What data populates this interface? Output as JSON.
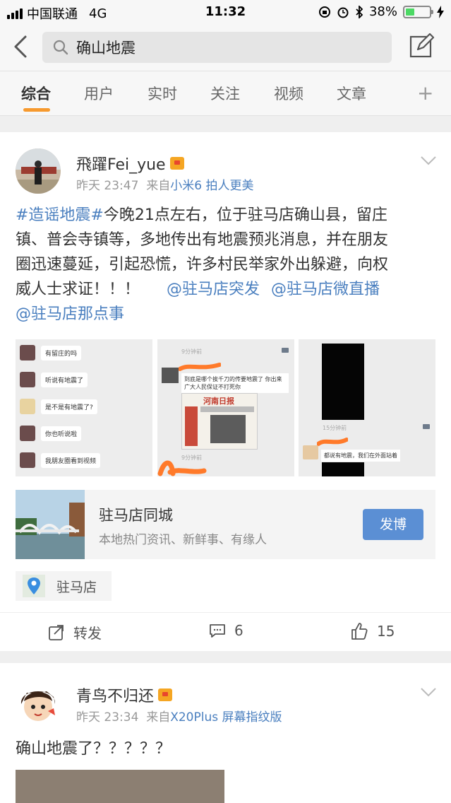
{
  "status_bar": {
    "carrier": "中国联通",
    "network": "4G",
    "time": "11:32",
    "battery": "38%",
    "battery_level": 0.38
  },
  "search": {
    "query": "确山地震"
  },
  "tabs": [
    {
      "label": "综合",
      "active": true
    },
    {
      "label": "用户"
    },
    {
      "label": "实时"
    },
    {
      "label": "关注"
    },
    {
      "label": "视频"
    },
    {
      "label": "文章"
    }
  ],
  "tab_plus": "+",
  "post1": {
    "username": "飛躍Fei_yue",
    "time": "昨天 23:47",
    "source_prefix": "来自",
    "source": "小米6 拍人更美",
    "text": {
      "hashtag": "#造谣地震#",
      "body_l1": "今晚21点左右，位于驻马店确山县，留庄",
      "body_l2": "镇、普会寺镇等，多地传出有地震预兆消息，并在朋友",
      "body_l3": "圈迅速蔓延，引起恐慌，许多村民举家外出躲避，向权",
      "body_l4": "威人士求证！！！",
      "mention1": "@驻马店突发",
      "mention2": "@驻马店微直播",
      "mention3": "@驻马店那点事"
    },
    "image1_chat": [
      "有留庄的吗",
      "听说有地震了",
      "是不是有地震了?",
      "你也听说啦",
      "我朋友圈看到视频"
    ],
    "image2": {
      "time_top": "9分钟前",
      "message": "到底是哪个挨千刀的传要地震了  你出来",
      "message2": "广大人民保证不打死你",
      "newspaper_title": "河南日报",
      "time_bottom": "9分钟前"
    },
    "image3": {
      "time": "15分钟前",
      "message": "都说有地震，我们在外面站着"
    },
    "page_card": {
      "title": "驻马店同城",
      "desc": "本地热门资讯、新鲜事、有缘人",
      "button": "发博"
    },
    "location": "驻马店",
    "actions": {
      "repost": "转发",
      "comments": "6",
      "likes": "15"
    }
  },
  "post2": {
    "username": "青鸟不归还",
    "time": "昨天 23:34",
    "source_prefix": "来自",
    "source": "X20Plus 屏幕指纹版",
    "text": "确山地震了？？？？？"
  },
  "colors": {
    "accent_orange": "#f79a2e",
    "link_blue": "#4a7fbf",
    "button_blue": "#5b8fd4"
  },
  "icons": [
    "back-icon",
    "search-icon",
    "compose-icon",
    "chevron-down-icon",
    "location-pin-icon",
    "repost-icon",
    "comment-icon",
    "like-icon"
  ]
}
